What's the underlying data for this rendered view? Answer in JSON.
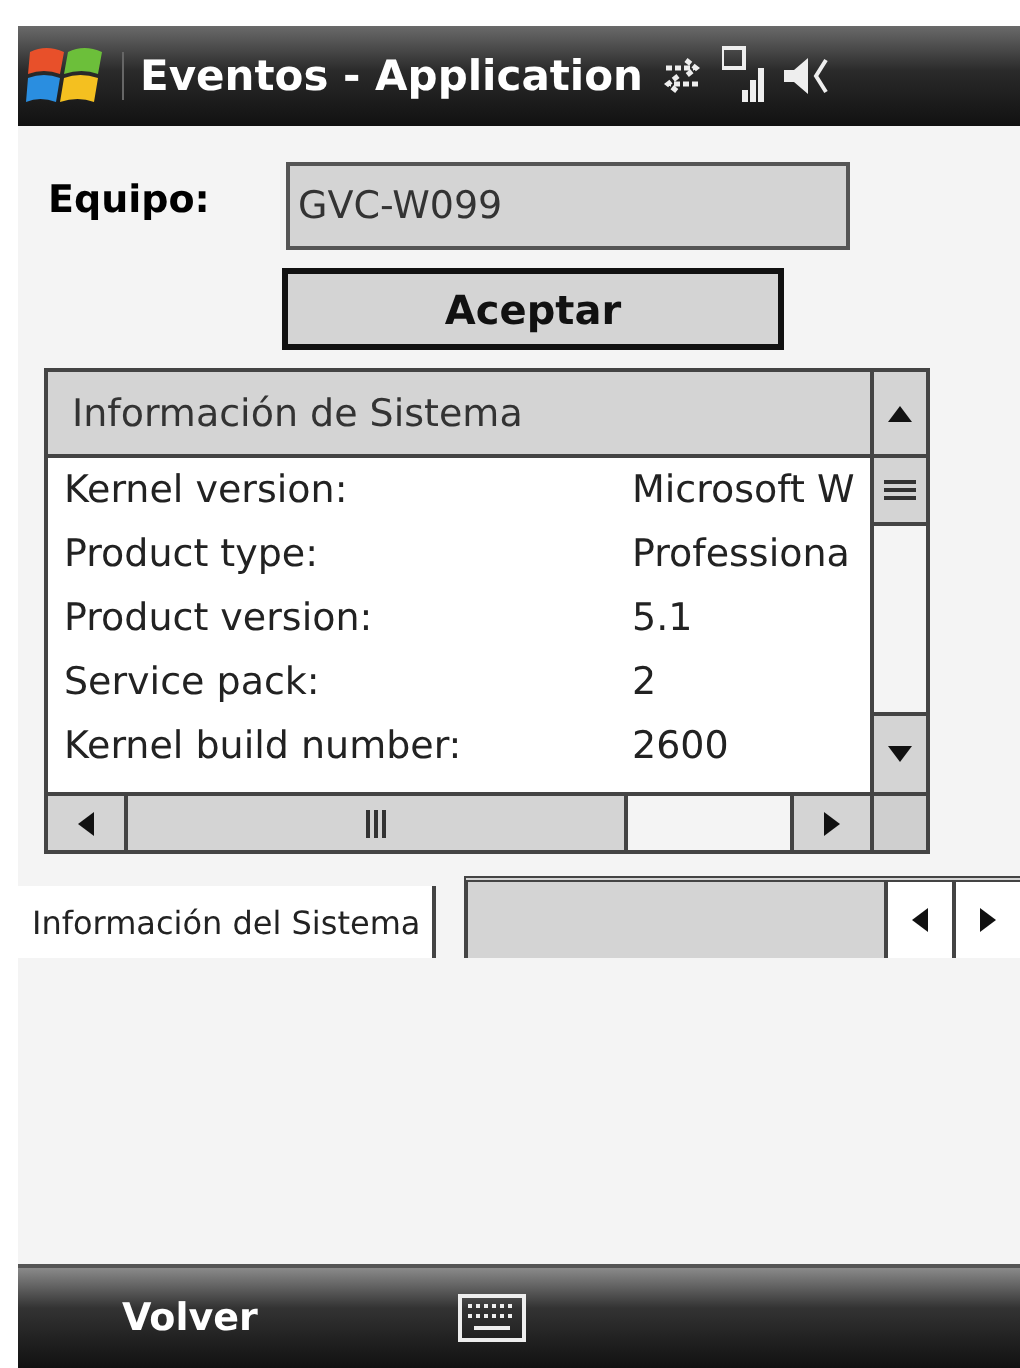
{
  "window": {
    "title": "Eventos - Application"
  },
  "form": {
    "label": "Equipo:",
    "value": "GVC-W099",
    "button": "Aceptar"
  },
  "list": {
    "header": "Información de Sistema",
    "rows": [
      {
        "name": "Kernel version:",
        "value": "Microsoft W"
      },
      {
        "name": "Product type:",
        "value": "Professiona"
      },
      {
        "name": "Product version:",
        "value": "5.1"
      },
      {
        "name": "Service pack:",
        "value": "2"
      },
      {
        "name": "Kernel build number:",
        "value": "2600"
      }
    ]
  },
  "tabs": [
    {
      "label": "Información del Sistema",
      "selected": true
    }
  ],
  "softkeys": {
    "left": "Volver"
  }
}
